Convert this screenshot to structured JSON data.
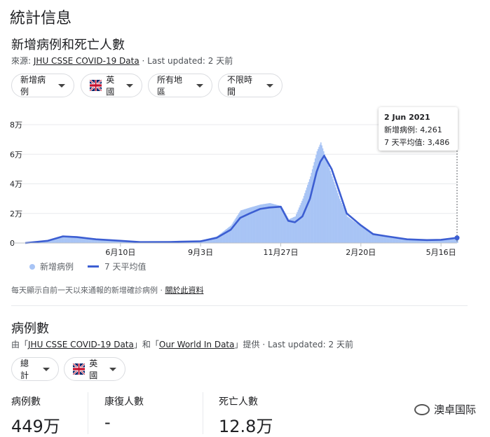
{
  "page": {
    "heading": "統計信息",
    "section1_title": "新增病例和死亡人數",
    "source_prefix": "來源:",
    "source_link": "JHU CSSE COVID-19 Data",
    "source_suffix": " · Last updated: 2 天前"
  },
  "filters": {
    "metric": "新增病例",
    "country": "英國",
    "region": "所有地區",
    "time": "不限時間"
  },
  "tooltip": {
    "date": "2 Jun 2021",
    "new_cases_label": "新增病例:",
    "new_cases_value": "4,261",
    "avg_label": "7 天平均值:",
    "avg_value": "3,486"
  },
  "chart_data": {
    "type": "area",
    "y_ticks": [
      "8万",
      "6万",
      "4万",
      "2万",
      "0"
    ],
    "y_tick_values": [
      80000,
      60000,
      40000,
      20000,
      0
    ],
    "x_ticks": [
      "6月10日",
      "9月3日",
      "11月27日",
      "2月20日",
      "5月16日"
    ],
    "ylim": [
      0,
      80000
    ],
    "series": [
      {
        "name": "新增病例",
        "type": "bar",
        "color": "#a8c4f5"
      },
      {
        "name": "7 天平均值",
        "type": "line",
        "color": "#3c5ed2"
      }
    ],
    "x": [
      "2020-03-01",
      "2020-03-25",
      "2020-04-10",
      "2020-04-25",
      "2020-05-15",
      "2020-06-10",
      "2020-07-01",
      "2020-08-01",
      "2020-09-03",
      "2020-09-20",
      "2020-10-05",
      "2020-10-15",
      "2020-10-25",
      "2020-11-05",
      "2020-11-15",
      "2020-11-27",
      "2020-12-05",
      "2020-12-12",
      "2020-12-20",
      "2020-12-28",
      "2021-01-04",
      "2021-01-08",
      "2021-01-12",
      "2021-01-20",
      "2021-01-28",
      "2021-02-05",
      "2021-02-20",
      "2021-03-05",
      "2021-03-20",
      "2021-04-10",
      "2021-05-01",
      "2021-05-16",
      "2021-06-02"
    ],
    "avg_values": [
      0,
      1500,
      4500,
      4000,
      2500,
      1500,
      600,
      700,
      1200,
      3500,
      9000,
      17000,
      20000,
      23000,
      24000,
      24500,
      15000,
      14000,
      18000,
      30000,
      48000,
      55000,
      59000,
      50000,
      35000,
      20000,
      12000,
      6000,
      4500,
      2500,
      2000,
      2200,
      3486
    ],
    "daily_values": [
      0,
      2000,
      5000,
      4500,
      2800,
      1300,
      700,
      900,
      1800,
      4500,
      12000,
      22000,
      24000,
      26000,
      27000,
      25000,
      16000,
      18000,
      30000,
      45000,
      62000,
      68000,
      60000,
      45000,
      30000,
      18000,
      11000,
      6500,
      4000,
      2700,
      2000,
      2100,
      4261
    ]
  },
  "legend": {
    "bar_label": "新增病例",
    "line_label": "7 天平均值"
  },
  "note": {
    "text": "每天顯示自前一天以來通報的新增確診病例 · ",
    "link": "關於此資料"
  },
  "section2": {
    "title": "病例數",
    "src_prefix": "由「",
    "src_link1": "JHU CSSE COVID-19 Data",
    "src_mid": "」和「",
    "src_link2": "Our World In Data",
    "src_suffix": "」提供 · Last updated: 2 天前",
    "filter_total": "總計",
    "filter_country": "英國",
    "stats": [
      {
        "label": "病例數",
        "value": "449万"
      },
      {
        "label": "康復人數",
        "value": "-"
      },
      {
        "label": "死亡人數",
        "value": "12.8万"
      }
    ],
    "watermark": "澳卓国际"
  },
  "colors": {
    "bar": "#a8c4f5",
    "line": "#3c5ed2"
  }
}
